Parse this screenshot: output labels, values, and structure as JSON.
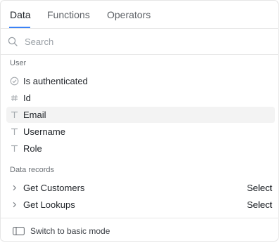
{
  "tabs": [
    {
      "label": "Data",
      "active": true
    },
    {
      "label": "Functions",
      "active": false
    },
    {
      "label": "Operators",
      "active": false
    }
  ],
  "search": {
    "placeholder": "Search",
    "value": "",
    "icon": "search-icon"
  },
  "sections": {
    "user": {
      "title": "User",
      "items": [
        {
          "label": "Is authenticated",
          "icon": "boolean-check-icon"
        },
        {
          "label": "Id",
          "icon": "hash-icon"
        },
        {
          "label": "Email",
          "icon": "text-icon",
          "highlighted": true
        },
        {
          "label": "Username",
          "icon": "text-icon"
        },
        {
          "label": "Role",
          "icon": "text-icon"
        }
      ]
    },
    "data_records": {
      "title": "Data records",
      "items": [
        {
          "label": "Get Customers",
          "icon": "chevron-right-icon",
          "action": "Select"
        },
        {
          "label": "Get Lookups",
          "icon": "chevron-right-icon",
          "action": "Select"
        }
      ]
    }
  },
  "footer": {
    "switch_label": "Switch to basic mode",
    "icon": "toggle-icon"
  },
  "colors": {
    "accent": "#3b82f6",
    "highlight": "#f3f3f3"
  }
}
